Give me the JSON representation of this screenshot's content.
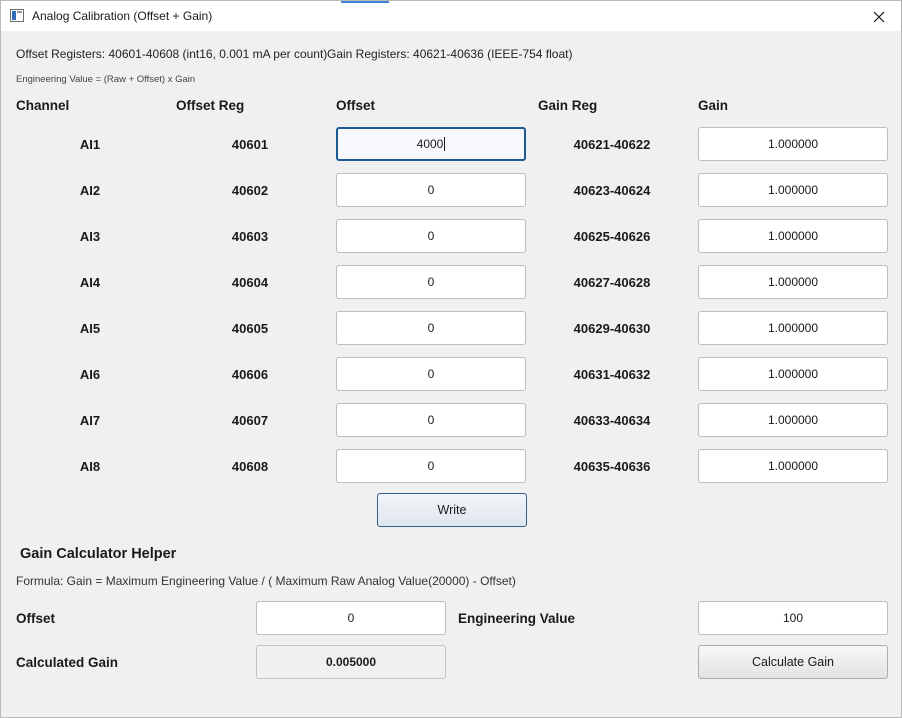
{
  "window": {
    "title": "Analog Calibration (Offset + Gain)"
  },
  "info": {
    "offset_registers": "Offset Registers: 40601-40608 (int16, 0.001 mA per count)",
    "gain_registers": "Gain Registers: 40621-40636 (IEEE-754 float)",
    "engineering_formula": "Engineering Value = (Raw + Offset) x Gain"
  },
  "table": {
    "headers": {
      "channel": "Channel",
      "offset_reg": "Offset Reg",
      "offset": "Offset",
      "gain_reg": "Gain Reg",
      "gain": "Gain"
    },
    "rows": [
      {
        "channel": "AI1",
        "offset_reg": "40601",
        "offset": "4000",
        "gain_reg": "40621-40622",
        "gain": "1.000000"
      },
      {
        "channel": "AI2",
        "offset_reg": "40602",
        "offset": "0",
        "gain_reg": "40623-40624",
        "gain": "1.000000"
      },
      {
        "channel": "AI3",
        "offset_reg": "40603",
        "offset": "0",
        "gain_reg": "40625-40626",
        "gain": "1.000000"
      },
      {
        "channel": "AI4",
        "offset_reg": "40604",
        "offset": "0",
        "gain_reg": "40627-40628",
        "gain": "1.000000"
      },
      {
        "channel": "AI5",
        "offset_reg": "40605",
        "offset": "0",
        "gain_reg": "40629-40630",
        "gain": "1.000000"
      },
      {
        "channel": "AI6",
        "offset_reg": "40606",
        "offset": "0",
        "gain_reg": "40631-40632",
        "gain": "1.000000"
      },
      {
        "channel": "AI7",
        "offset_reg": "40607",
        "offset": "0",
        "gain_reg": "40633-40634",
        "gain": "1.000000"
      },
      {
        "channel": "AI8",
        "offset_reg": "40608",
        "offset": "0",
        "gain_reg": "40635-40636",
        "gain": "1.000000"
      }
    ],
    "write_label": "Write"
  },
  "calculator": {
    "title": "Gain Calculator Helper",
    "formula": "Formula: Gain = Maximum Engineering Value / ( Maximum Raw Analog Value(20000) - Offset)",
    "offset_label": "Offset",
    "offset_value": "0",
    "eng_label": "Engineering Value",
    "eng_value": "100",
    "gain_label": "Calculated Gain",
    "gain_value": "0.005000",
    "calc_label": "Calculate Gain"
  }
}
